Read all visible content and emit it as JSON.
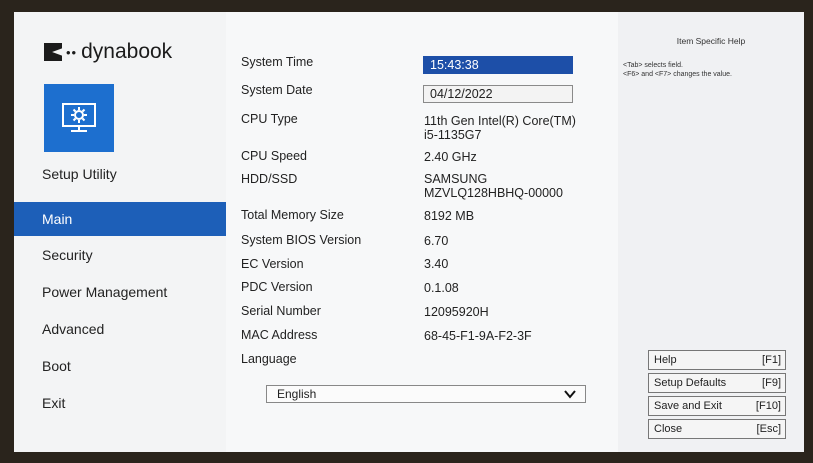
{
  "brand": {
    "name": "dynabook",
    "dots": "••"
  },
  "sidebar": {
    "setup_label": "Setup Utility",
    "items": [
      {
        "label": "Main"
      },
      {
        "label": "Security"
      },
      {
        "label": "Power Management"
      },
      {
        "label": "Advanced"
      },
      {
        "label": "Boot"
      },
      {
        "label": "Exit"
      }
    ]
  },
  "main": {
    "system_time": {
      "label": "System Time",
      "value": "15:43:38"
    },
    "system_date": {
      "label": "System Date",
      "value": "04/12/2022"
    },
    "cpu_type": {
      "label": "CPU Type",
      "value_line1": "11th Gen Intel(R) Core(TM)",
      "value_line2": "i5-1135G7"
    },
    "cpu_speed": {
      "label": "CPU Speed",
      "value": "2.40 GHz"
    },
    "hdd": {
      "label": "HDD/SSD",
      "value_line1": "SAMSUNG",
      "value_line2": "MZVLQ128HBHQ-00000"
    },
    "memory": {
      "label": "Total Memory Size",
      "value": "8192 MB"
    },
    "bios": {
      "label": "System BIOS Version",
      "value": "6.70"
    },
    "ec": {
      "label": "EC Version",
      "value": "3.40"
    },
    "pdc": {
      "label": "PDC Version",
      "value": "0.1.08"
    },
    "serial": {
      "label": "Serial Number",
      "value": "12095920H"
    },
    "mac": {
      "label": "MAC Address",
      "value": "68-45-F1-9A-F2-3F"
    },
    "language": {
      "label": "Language",
      "selected": "English"
    }
  },
  "help": {
    "title": "Item Specific Help",
    "line1": "<Tab> selects field.",
    "line2": "<F6> and <F7> changes the value.",
    "keys": [
      {
        "label": "Help",
        "key": "[F1]"
      },
      {
        "label": "Setup Defaults",
        "key": "[F9]"
      },
      {
        "label": "Save and Exit",
        "key": "[F10]"
      },
      {
        "label": "Close",
        "key": "[Esc]"
      }
    ]
  },
  "colors": {
    "accent": "#1d5fb8",
    "selected_field": "#1d4fa8"
  }
}
